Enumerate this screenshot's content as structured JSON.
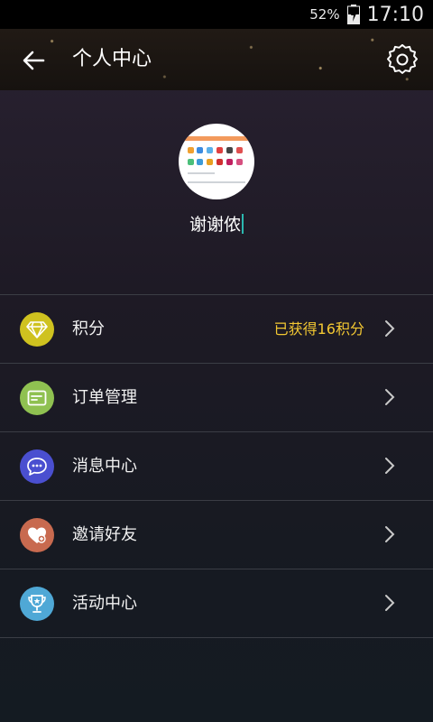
{
  "status_bar": {
    "battery_percent": "52%",
    "time": "17:10"
  },
  "app_bar": {
    "title": "个人中心",
    "back_icon": "arrow-left-icon",
    "settings_icon": "gear-icon"
  },
  "profile": {
    "username": "谢谢侬"
  },
  "menu": {
    "items": [
      {
        "label": "积分",
        "value": "已获得16积分",
        "icon": "diamond-icon",
        "color": "#cfc21f"
      },
      {
        "label": "订单管理",
        "value": "",
        "icon": "order-card-icon",
        "color": "#8fc151"
      },
      {
        "label": "消息中心",
        "value": "",
        "icon": "message-bubble-icon",
        "color": "#4a4fd0"
      },
      {
        "label": "邀请好友",
        "value": "",
        "icon": "heart-icon",
        "color": "#c86a4f"
      },
      {
        "label": "活动中心",
        "value": "",
        "icon": "trophy-icon",
        "color": "#4fa8d6"
      }
    ]
  },
  "colors": {
    "accent_value": "#f3c832",
    "divider": "#3b3d45"
  }
}
